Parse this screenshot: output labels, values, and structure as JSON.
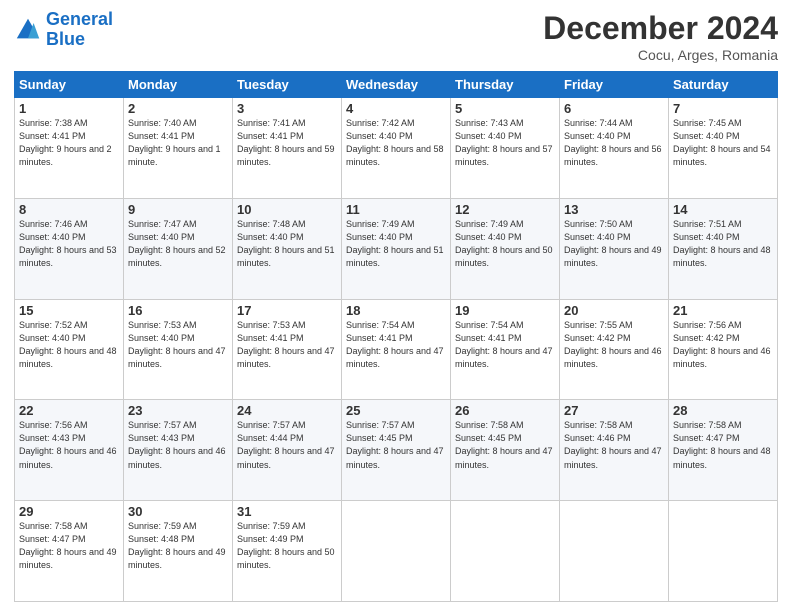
{
  "header": {
    "logo_line1": "General",
    "logo_line2": "Blue",
    "month_title": "December 2024",
    "subtitle": "Cocu, Arges, Romania"
  },
  "days_of_week": [
    "Sunday",
    "Monday",
    "Tuesday",
    "Wednesday",
    "Thursday",
    "Friday",
    "Saturday"
  ],
  "weeks": [
    [
      {
        "day": "1",
        "sunrise": "7:38 AM",
        "sunset": "4:41 PM",
        "daylight": "9 hours and 2 minutes."
      },
      {
        "day": "2",
        "sunrise": "7:40 AM",
        "sunset": "4:41 PM",
        "daylight": "9 hours and 1 minute."
      },
      {
        "day": "3",
        "sunrise": "7:41 AM",
        "sunset": "4:41 PM",
        "daylight": "8 hours and 59 minutes."
      },
      {
        "day": "4",
        "sunrise": "7:42 AM",
        "sunset": "4:40 PM",
        "daylight": "8 hours and 58 minutes."
      },
      {
        "day": "5",
        "sunrise": "7:43 AM",
        "sunset": "4:40 PM",
        "daylight": "8 hours and 57 minutes."
      },
      {
        "day": "6",
        "sunrise": "7:44 AM",
        "sunset": "4:40 PM",
        "daylight": "8 hours and 56 minutes."
      },
      {
        "day": "7",
        "sunrise": "7:45 AM",
        "sunset": "4:40 PM",
        "daylight": "8 hours and 54 minutes."
      }
    ],
    [
      {
        "day": "8",
        "sunrise": "7:46 AM",
        "sunset": "4:40 PM",
        "daylight": "8 hours and 53 minutes."
      },
      {
        "day": "9",
        "sunrise": "7:47 AM",
        "sunset": "4:40 PM",
        "daylight": "8 hours and 52 minutes."
      },
      {
        "day": "10",
        "sunrise": "7:48 AM",
        "sunset": "4:40 PM",
        "daylight": "8 hours and 51 minutes."
      },
      {
        "day": "11",
        "sunrise": "7:49 AM",
        "sunset": "4:40 PM",
        "daylight": "8 hours and 51 minutes."
      },
      {
        "day": "12",
        "sunrise": "7:49 AM",
        "sunset": "4:40 PM",
        "daylight": "8 hours and 50 minutes."
      },
      {
        "day": "13",
        "sunrise": "7:50 AM",
        "sunset": "4:40 PM",
        "daylight": "8 hours and 49 minutes."
      },
      {
        "day": "14",
        "sunrise": "7:51 AM",
        "sunset": "4:40 PM",
        "daylight": "8 hours and 48 minutes."
      }
    ],
    [
      {
        "day": "15",
        "sunrise": "7:52 AM",
        "sunset": "4:40 PM",
        "daylight": "8 hours and 48 minutes."
      },
      {
        "day": "16",
        "sunrise": "7:53 AM",
        "sunset": "4:40 PM",
        "daylight": "8 hours and 47 minutes."
      },
      {
        "day": "17",
        "sunrise": "7:53 AM",
        "sunset": "4:41 PM",
        "daylight": "8 hours and 47 minutes."
      },
      {
        "day": "18",
        "sunrise": "7:54 AM",
        "sunset": "4:41 PM",
        "daylight": "8 hours and 47 minutes."
      },
      {
        "day": "19",
        "sunrise": "7:54 AM",
        "sunset": "4:41 PM",
        "daylight": "8 hours and 47 minutes."
      },
      {
        "day": "20",
        "sunrise": "7:55 AM",
        "sunset": "4:42 PM",
        "daylight": "8 hours and 46 minutes."
      },
      {
        "day": "21",
        "sunrise": "7:56 AM",
        "sunset": "4:42 PM",
        "daylight": "8 hours and 46 minutes."
      }
    ],
    [
      {
        "day": "22",
        "sunrise": "7:56 AM",
        "sunset": "4:43 PM",
        "daylight": "8 hours and 46 minutes."
      },
      {
        "day": "23",
        "sunrise": "7:57 AM",
        "sunset": "4:43 PM",
        "daylight": "8 hours and 46 minutes."
      },
      {
        "day": "24",
        "sunrise": "7:57 AM",
        "sunset": "4:44 PM",
        "daylight": "8 hours and 47 minutes."
      },
      {
        "day": "25",
        "sunrise": "7:57 AM",
        "sunset": "4:45 PM",
        "daylight": "8 hours and 47 minutes."
      },
      {
        "day": "26",
        "sunrise": "7:58 AM",
        "sunset": "4:45 PM",
        "daylight": "8 hours and 47 minutes."
      },
      {
        "day": "27",
        "sunrise": "7:58 AM",
        "sunset": "4:46 PM",
        "daylight": "8 hours and 47 minutes."
      },
      {
        "day": "28",
        "sunrise": "7:58 AM",
        "sunset": "4:47 PM",
        "daylight": "8 hours and 48 minutes."
      }
    ],
    [
      {
        "day": "29",
        "sunrise": "7:58 AM",
        "sunset": "4:47 PM",
        "daylight": "8 hours and 49 minutes."
      },
      {
        "day": "30",
        "sunrise": "7:59 AM",
        "sunset": "4:48 PM",
        "daylight": "8 hours and 49 minutes."
      },
      {
        "day": "31",
        "sunrise": "7:59 AM",
        "sunset": "4:49 PM",
        "daylight": "8 hours and 50 minutes."
      },
      null,
      null,
      null,
      null
    ]
  ]
}
